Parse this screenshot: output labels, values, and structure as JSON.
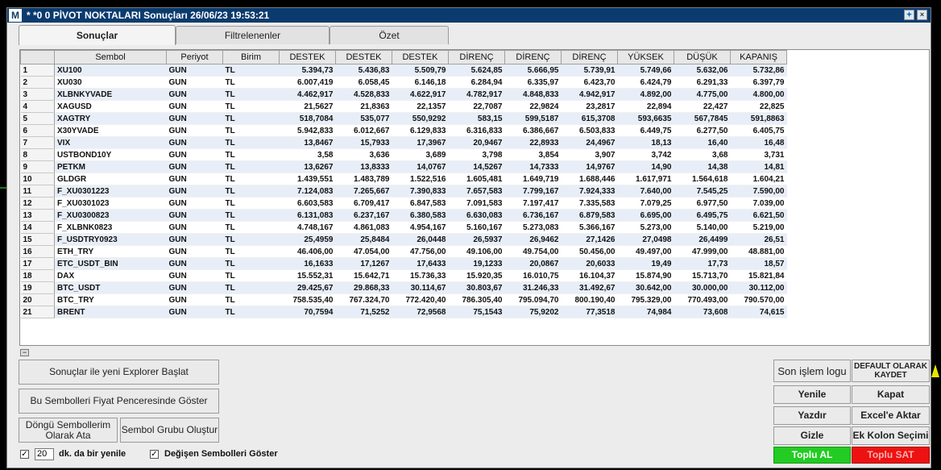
{
  "window": {
    "app_icon": "M",
    "title": "* *0  0 PİVOT NOKTALARI Sonuçları  26/06/23 19:53:21"
  },
  "tabs": [
    "Sonuçlar",
    "Filtrelenenler",
    "Özet"
  ],
  "table": {
    "headers": [
      "Sembol",
      "Periyot",
      "Birim",
      "DESTEK",
      "DESTEK",
      "DESTEK",
      "DİRENÇ",
      "DİRENÇ",
      "DİRENÇ",
      "YÜKSEK",
      "DÜŞÜK",
      "KAPANIŞ"
    ],
    "rows": [
      [
        "1",
        "XU100",
        "GUN",
        "TL",
        "5.394,73",
        "5.436,83",
        "5.509,79",
        "5.624,85",
        "5.666,95",
        "5.739,91",
        "5.749,66",
        "5.632,06",
        "5.732,86"
      ],
      [
        "2",
        "XU030",
        "GUN",
        "TL",
        "6.007,419",
        "6.058,45",
        "6.146,18",
        "6.284,94",
        "6.335,97",
        "6.423,70",
        "6.424,79",
        "6.291,33",
        "6.397,79"
      ],
      [
        "3",
        "XLBNKYVADE",
        "GUN",
        "TL",
        "4.462,917",
        "4.528,833",
        "4.622,917",
        "4.782,917",
        "4.848,833",
        "4.942,917",
        "4.892,00",
        "4.775,00",
        "4.800,00"
      ],
      [
        "4",
        "XAGUSD",
        "GUN",
        "TL",
        "21,5627",
        "21,8363",
        "22,1357",
        "22,7087",
        "22,9824",
        "23,2817",
        "22,894",
        "22,427",
        "22,825"
      ],
      [
        "5",
        "XAGTRY",
        "GUN",
        "TL",
        "518,7084",
        "535,077",
        "550,9292",
        "583,15",
        "599,5187",
        "615,3708",
        "593,6635",
        "567,7845",
        "591,8863"
      ],
      [
        "6",
        "X30YVADE",
        "GUN",
        "TL",
        "5.942,833",
        "6.012,667",
        "6.129,833",
        "6.316,833",
        "6.386,667",
        "6.503,833",
        "6.449,75",
        "6.277,50",
        "6.405,75"
      ],
      [
        "7",
        "VIX",
        "GUN",
        "TL",
        "13,8467",
        "15,7933",
        "17,3967",
        "20,9467",
        "22,8933",
        "24,4967",
        "18,13",
        "16,40",
        "16,48"
      ],
      [
        "8",
        "USTBOND10Y",
        "GUN",
        "TL",
        "3,58",
        "3,636",
        "3,689",
        "3,798",
        "3,854",
        "3,907",
        "3,742",
        "3,68",
        "3,731"
      ],
      [
        "9",
        "PETKM",
        "GUN",
        "TL",
        "13,6267",
        "13,8333",
        "14,0767",
        "14,5267",
        "14,7333",
        "14,9767",
        "14,90",
        "14,38",
        "14,81"
      ],
      [
        "10",
        "GLDGR",
        "GUN",
        "TL",
        "1.439,551",
        "1.483,789",
        "1.522,516",
        "1.605,481",
        "1.649,719",
        "1.688,446",
        "1.617,971",
        "1.564,618",
        "1.604,21"
      ],
      [
        "11",
        "F_XU0301223",
        "GUN",
        "TL",
        "7.124,083",
        "7.265,667",
        "7.390,833",
        "7.657,583",
        "7.799,167",
        "7.924,333",
        "7.640,00",
        "7.545,25",
        "7.590,00"
      ],
      [
        "12",
        "F_XU0301023",
        "GUN",
        "TL",
        "6.603,583",
        "6.709,417",
        "6.847,583",
        "7.091,583",
        "7.197,417",
        "7.335,583",
        "7.079,25",
        "6.977,50",
        "7.039,00"
      ],
      [
        "13",
        "F_XU0300823",
        "GUN",
        "TL",
        "6.131,083",
        "6.237,167",
        "6.380,583",
        "6.630,083",
        "6.736,167",
        "6.879,583",
        "6.695,00",
        "6.495,75",
        "6.621,50"
      ],
      [
        "14",
        "F_XLBNK0823",
        "GUN",
        "TL",
        "4.748,167",
        "4.861,083",
        "4.954,167",
        "5.160,167",
        "5.273,083",
        "5.366,167",
        "5.273,00",
        "5.140,00",
        "5.219,00"
      ],
      [
        "15",
        "F_USDTRY0923",
        "GUN",
        "TL",
        "25,4959",
        "25,8484",
        "26,0448",
        "26,5937",
        "26,9462",
        "27,1426",
        "27,0498",
        "26,4499",
        "26,51"
      ],
      [
        "16",
        "ETH_TRY",
        "GUN",
        "TL",
        "46.406,00",
        "47.054,00",
        "47.756,00",
        "49.106,00",
        "49.754,00",
        "50.456,00",
        "49.497,00",
        "47.999,00",
        "48.881,00"
      ],
      [
        "17",
        "ETC_USDT_BIN",
        "GUN",
        "TL",
        "16,1633",
        "17,1267",
        "17,6433",
        "19,1233",
        "20,0867",
        "20,6033",
        "19,49",
        "17,73",
        "18,57"
      ],
      [
        "18",
        "DAX",
        "GUN",
        "TL",
        "15.552,31",
        "15.642,71",
        "15.736,33",
        "15.920,35",
        "16.010,75",
        "16.104,37",
        "15.874,90",
        "15.713,70",
        "15.821,84"
      ],
      [
        "19",
        "BTC_USDT",
        "GUN",
        "TL",
        "29.425,67",
        "29.868,33",
        "30.114,67",
        "30.803,67",
        "31.246,33",
        "31.492,67",
        "30.642,00",
        "30.000,00",
        "30.112,00"
      ],
      [
        "20",
        "BTC_TRY",
        "GUN",
        "TL",
        "758.535,40",
        "767.324,70",
        "772.420,40",
        "786.305,40",
        "795.094,70",
        "800.190,40",
        "795.329,00",
        "770.493,00",
        "790.570,00"
      ],
      [
        "21",
        "BRENT",
        "GUN",
        "TL",
        "70,7594",
        "71,5252",
        "72,9568",
        "75,1543",
        "75,9202",
        "77,3518",
        "74,984",
        "73,608",
        "74,615"
      ]
    ]
  },
  "buttons": {
    "new_explorer": "Sonuçlar ile yeni Explorer Başlat",
    "show_in_price": "Bu Sembolleri Fiyat Penceresinde Göster",
    "assign_loop": "Döngü Sembollerim Olarak Ata",
    "create_group": "Sembol Grubu Oluştur",
    "last_log": "Son işlem logu",
    "save_default": "DEFAULT OLARAK KAYDET",
    "refresh": "Yenile",
    "close": "Kapat",
    "print": "Yazdır",
    "excel": "Excel'e Aktar",
    "hide": "Gizle",
    "extra_column": "Ek Kolon Seçimi",
    "bulk_buy": "Toplu AL",
    "bulk_sell": "Toplu SAT"
  },
  "options": {
    "refresh_minutes": "20",
    "refresh_label": "dk. da bir yenile",
    "changed_label": "Değişen Sembolleri Göster",
    "check_mark": "✓"
  },
  "colors": {
    "title_bar": "#0b3b6e",
    "buy": "#22cc22",
    "sell": "#ee1111",
    "alt_row": "#e8eef8"
  }
}
